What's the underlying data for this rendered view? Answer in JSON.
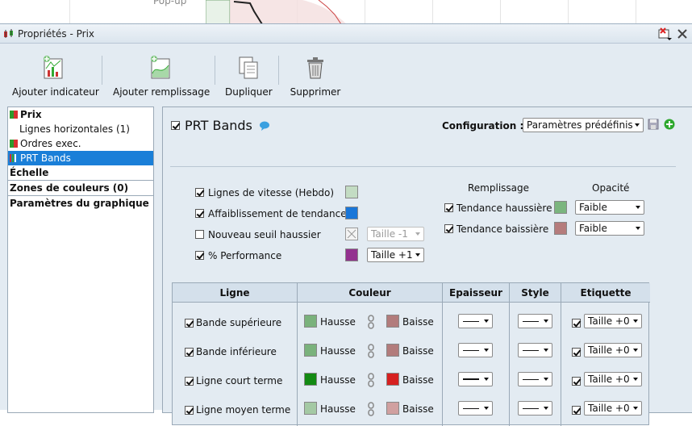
{
  "background": {
    "partial_text": "Pop-up"
  },
  "window": {
    "title": "Propriétés - Prix"
  },
  "toolbar": {
    "add_indicator": "Ajouter indicateur",
    "add_fill": "Ajouter remplissage",
    "duplicate": "Dupliquer",
    "delete": "Supprimer"
  },
  "tree": {
    "items": [
      {
        "label": "Prix"
      },
      {
        "label": "Lignes horizontales (1)"
      },
      {
        "label": "Ordres exec."
      },
      {
        "label": "PRT Bands"
      },
      {
        "label": "Échelle"
      },
      {
        "label": "Zones de couleurs (0)"
      },
      {
        "label": "Paramètres du graphique"
      }
    ]
  },
  "panel": {
    "indicator_name": "PRT Bands",
    "configuration_label": "Configuration :",
    "configuration_value": "Paramètres prédéfinis",
    "options": [
      {
        "label": "Lignes de vitesse (Hebdo)",
        "checked": true,
        "color": "#c3dcc3"
      },
      {
        "label": "Affaiblissement de tendance",
        "checked": true,
        "color": "#1976d8"
      },
      {
        "label": "Nouveau seuil haussier",
        "checked": false,
        "size": "Taille -1"
      },
      {
        "label": "% Performance",
        "checked": true,
        "color": "#93308f",
        "size": "Taille +1"
      }
    ],
    "fill_header": "Remplissage",
    "opacity_header": "Opacité",
    "fills": [
      {
        "label": "Tendance haussière",
        "checked": true,
        "color": "#7bb57e",
        "opacity": "Faible"
      },
      {
        "label": "Tendance baissière",
        "checked": true,
        "color": "#b57c7c",
        "opacity": "Faible"
      }
    ],
    "table": {
      "headers": {
        "line": "Ligne",
        "color": "Couleur",
        "thickness": "Epaisseur",
        "style": "Style",
        "label": "Etiquette"
      },
      "rise_label": "Hausse",
      "fall_label": "Baisse",
      "rows": [
        {
          "name": "Bande supérieure",
          "checked": true,
          "rise_color": "#7ab27c",
          "fall_color": "#b27c7c",
          "label_checked": true,
          "label_size": "Taille +0"
        },
        {
          "name": "Bande inférieure",
          "checked": true,
          "rise_color": "#7ab27c",
          "fall_color": "#b27c7c",
          "label_checked": true,
          "label_size": "Taille +0"
        },
        {
          "name": "Ligne court terme",
          "checked": true,
          "rise_color": "#138a13",
          "fall_color": "#d62020",
          "label_checked": true,
          "label_size": "Taille +0"
        },
        {
          "name": "Ligne moyen terme",
          "checked": true,
          "rise_color": "#a4c9a4",
          "fall_color": "#d0a0a0",
          "label_checked": true,
          "label_size": "Taille +0"
        }
      ]
    }
  }
}
